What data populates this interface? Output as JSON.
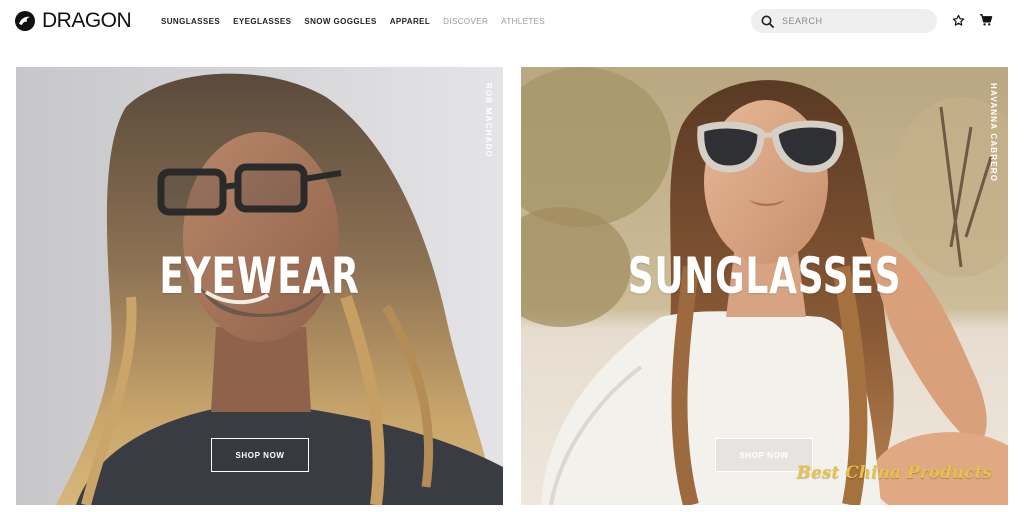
{
  "header": {
    "logo_text": "DRAGON",
    "nav": [
      {
        "label": "SUNGLASSES",
        "muted": false
      },
      {
        "label": "EYEGLASSES",
        "muted": false
      },
      {
        "label": "SNOW GOGGLES",
        "muted": false
      },
      {
        "label": "APPAREL",
        "muted": false
      },
      {
        "label": "DISCOVER",
        "muted": true
      },
      {
        "label": "ATHLETES",
        "muted": true
      }
    ],
    "search": {
      "placeholder": "SEARCH",
      "value": ""
    },
    "icons": {
      "search": "search-icon",
      "wishlist": "star-icon",
      "cart": "cart-icon"
    }
  },
  "panels": [
    {
      "title": "EYEWEAR",
      "athlete": "ROB MACHADO",
      "cta": "SHOP NOW"
    },
    {
      "title": "SUNGLASSES",
      "athlete": "HAVANNA CABRERO",
      "cta": "SHOP NOW"
    }
  ],
  "watermark": "Best China Products",
  "colors": {
    "accent": "#111111",
    "nav_muted": "#9a9a9a",
    "search_bg": "#efefef",
    "watermark": "#e8c14a"
  }
}
